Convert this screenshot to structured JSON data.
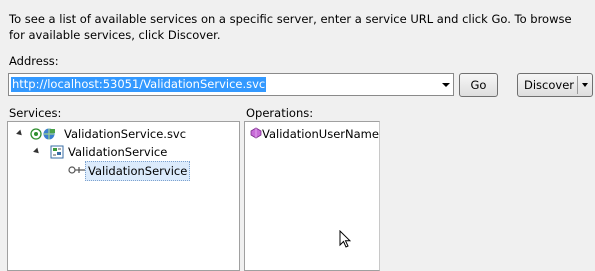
{
  "instructions": "To see a list of available services on a specific server, enter a service URL and click Go. To browse for available services, click Discover.",
  "address": {
    "label": "Address:",
    "value": "http://localhost:53051/ValidationService.svc"
  },
  "buttons": {
    "go": "Go",
    "discover": "Discover"
  },
  "services": {
    "label": "Services:",
    "tree": [
      {
        "label": "ValidationService.svc",
        "icon": "web-service-icon",
        "expanded": true
      },
      {
        "label": "ValidationService",
        "icon": "namespace-icon",
        "expanded": true
      },
      {
        "label": "ValidationService",
        "icon": "contract-icon",
        "selected": true
      }
    ]
  },
  "operations": {
    "label": "Operations:",
    "items": [
      {
        "label": "ValidationUserName",
        "icon": "method-icon"
      }
    ]
  }
}
